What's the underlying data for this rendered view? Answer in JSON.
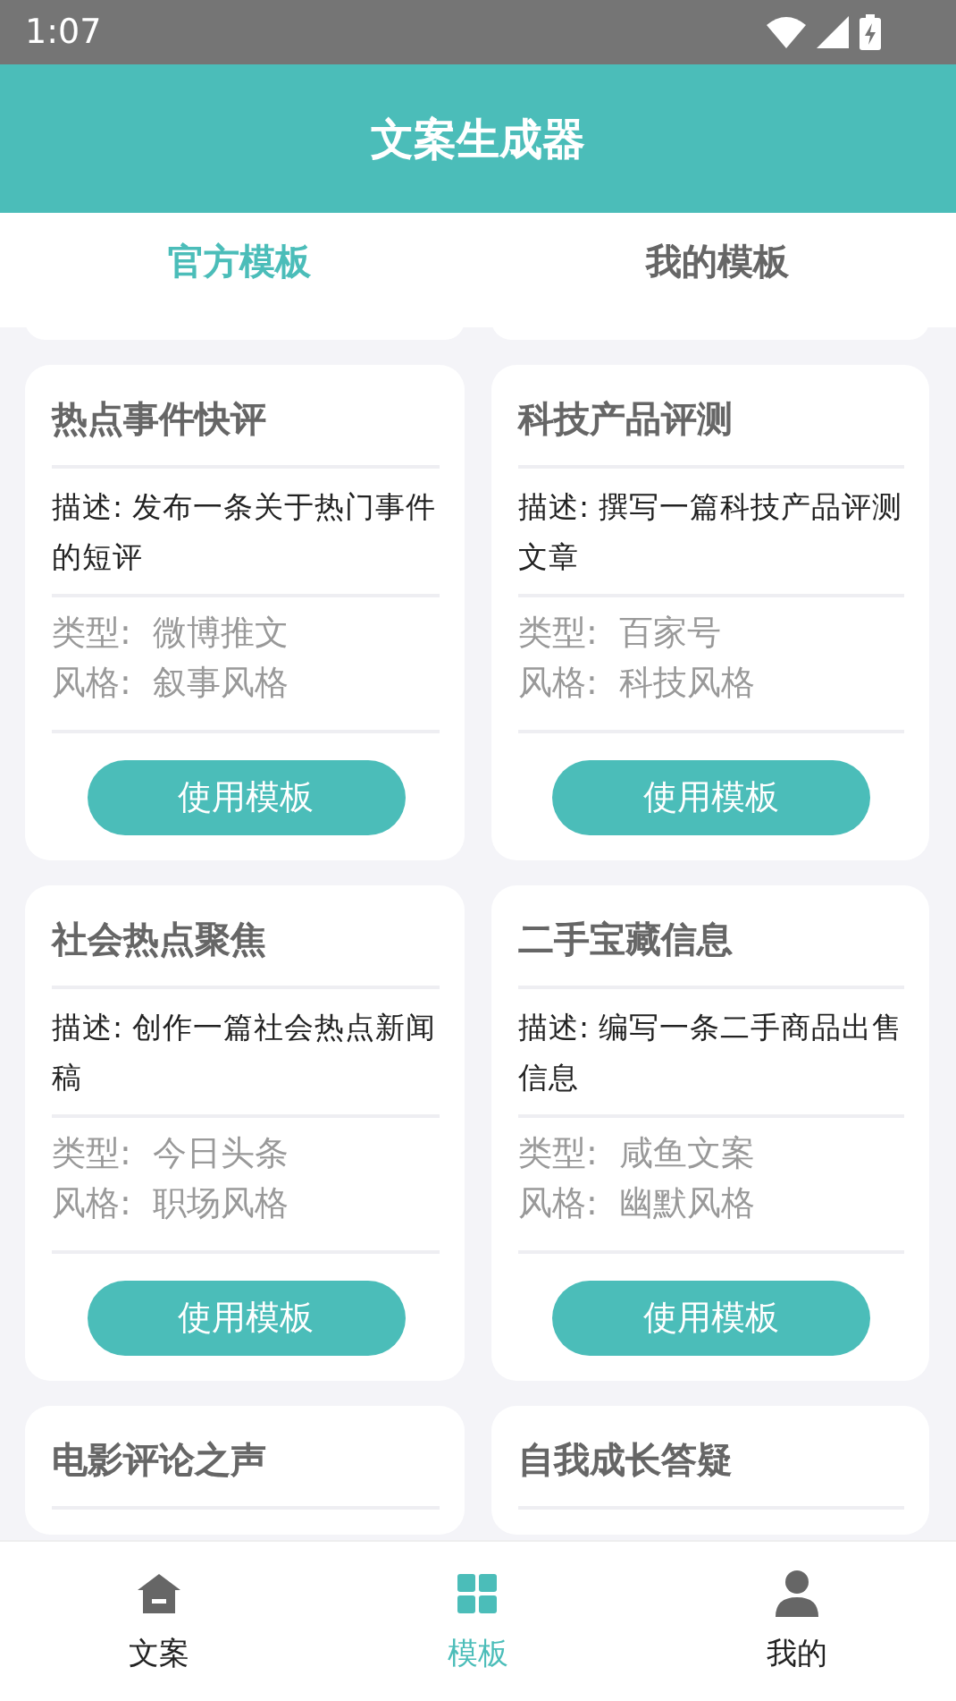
{
  "status_bar": {
    "time": "1:07"
  },
  "app_bar": {
    "title": "文案生成器"
  },
  "tabs": [
    {
      "label": "官方模板",
      "selected": true
    },
    {
      "label": "我的模板",
      "selected": false
    }
  ],
  "templates": [
    {
      "title": "热点事件快评",
      "description": "描述: 发布一条关于热门事件的短评",
      "type": "类型:  微博推文",
      "style": "风格:  叙事风格",
      "button": "使用模板"
    },
    {
      "title": "科技产品评测",
      "description": "描述: 撰写一篇科技产品评测文章",
      "type": "类型:  百家号",
      "style": "风格:  科技风格",
      "button": "使用模板"
    },
    {
      "title": "社会热点聚焦",
      "description": "描述: 创作一篇社会热点新闻稿",
      "type": "类型:  今日头条",
      "style": "风格:  职场风格",
      "button": "使用模板"
    },
    {
      "title": "二手宝藏信息",
      "description": "描述: 编写一条二手商品出售信息",
      "type": "类型:  咸鱼文案",
      "style": "风格:  幽默风格",
      "button": "使用模板"
    },
    {
      "title": "电影评论之声"
    },
    {
      "title": "自我成长答疑"
    }
  ],
  "bottom_nav": [
    {
      "label": "文案",
      "kind": "home",
      "selected": false
    },
    {
      "label": "模板",
      "kind": "grid",
      "selected": true
    },
    {
      "label": "我的",
      "kind": "person",
      "selected": false
    }
  ]
}
